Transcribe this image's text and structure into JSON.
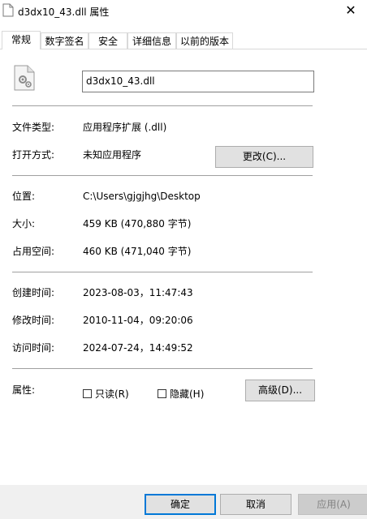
{
  "window": {
    "title": "d3dx10_43.dll 属性",
    "close_glyph": "✕"
  },
  "tabs": [
    {
      "label": "常规",
      "active": true
    },
    {
      "label": "数字签名"
    },
    {
      "label": "安全"
    },
    {
      "label": "详细信息"
    },
    {
      "label": "以前的版本"
    }
  ],
  "general": {
    "file_name": "d3dx10_43.dll",
    "file_type_label": "文件类型:",
    "file_type_value": "应用程序扩展 (.dll)",
    "opens_with_label": "打开方式:",
    "opens_with_value": "未知应用程序",
    "change_button": "更改(C)...",
    "location_label": "位置:",
    "location_value": "C:\\Users\\gjgjhg\\Desktop",
    "size_label": "大小:",
    "size_value": "459 KB (470,880 字节)",
    "size_on_disk_label": "占用空间:",
    "size_on_disk_value": "460 KB (471,040 字节)",
    "created_label": "创建时间:",
    "created_value": "2023-08-03，11:47:43",
    "modified_label": "修改时间:",
    "modified_value": "2010-11-04，09:20:06",
    "accessed_label": "访问时间:",
    "accessed_value": "2024-07-24，14:49:52",
    "attributes_label": "属性:",
    "readonly_label": "只读(R)",
    "readonly_checked": false,
    "hidden_label": "隐藏(H)",
    "hidden_checked": false,
    "advanced_button": "高级(D)..."
  },
  "footer": {
    "ok": "确定",
    "cancel": "取消",
    "apply": "应用(A)"
  }
}
